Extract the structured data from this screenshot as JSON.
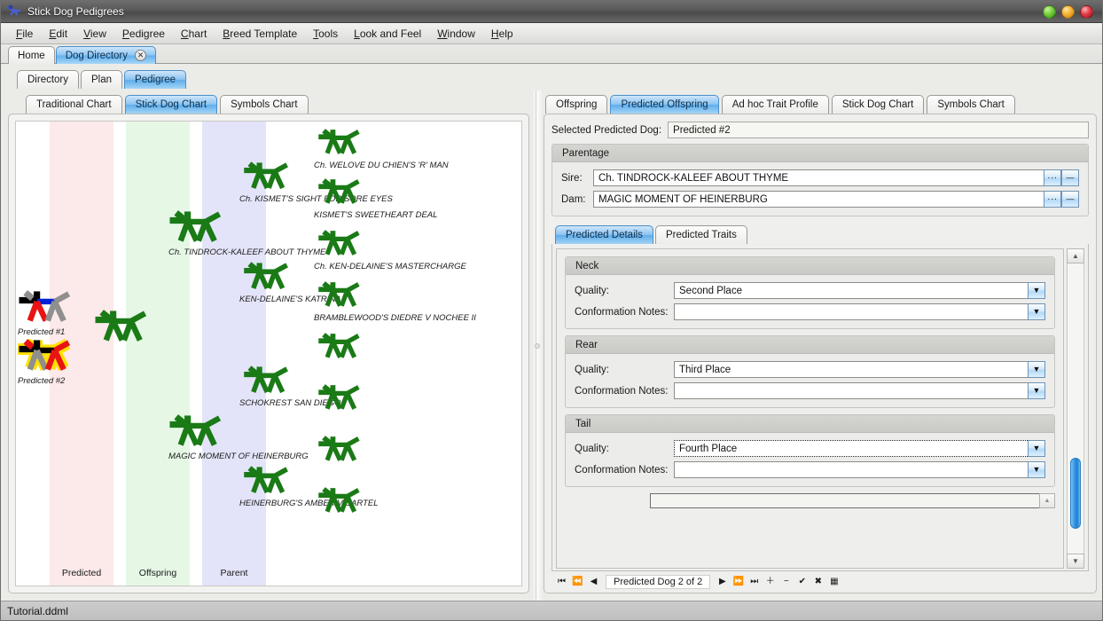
{
  "window": {
    "title": "Stick Dog Pedigrees",
    "app_icon": "stick-dog-icon",
    "buttons": {
      "minimize": "minimize",
      "maximize": "maximize",
      "close": "close"
    }
  },
  "menubar": [
    {
      "label": "File",
      "mnemonic": "F"
    },
    {
      "label": "Edit",
      "mnemonic": "E"
    },
    {
      "label": "View",
      "mnemonic": "V"
    },
    {
      "label": "Pedigree",
      "mnemonic": "P"
    },
    {
      "label": "Chart",
      "mnemonic": "C"
    },
    {
      "label": "Breed Template",
      "mnemonic": "B"
    },
    {
      "label": "Tools",
      "mnemonic": "T"
    },
    {
      "label": "Look and Feel",
      "mnemonic": "L"
    },
    {
      "label": "Window",
      "mnemonic": "W"
    },
    {
      "label": "Help",
      "mnemonic": "H"
    }
  ],
  "document_tabs": [
    {
      "label": "Home",
      "active": false,
      "closable": false
    },
    {
      "label": "Dog Directory",
      "active": true,
      "closable": true,
      "close_glyph": "✕"
    }
  ],
  "inner_tabs": [
    {
      "label": "Directory",
      "active": false
    },
    {
      "label": "Plan",
      "active": false
    },
    {
      "label": "Pedigree",
      "active": true
    }
  ],
  "left_pane": {
    "tabs": [
      {
        "label": "Traditional Chart",
        "active": false
      },
      {
        "label": "Stick Dog Chart",
        "active": true
      },
      {
        "label": "Symbols Chart",
        "active": false
      }
    ],
    "chart": {
      "bands": [
        {
          "label": "Predicted",
          "color": "#fce9e9"
        },
        {
          "label": "Offspring",
          "color": "#e6f7e6"
        },
        {
          "label": "Parent",
          "color": "#e3e4f9"
        }
      ],
      "generation_color": "#1a7a16",
      "dogs": [
        {
          "name": "Predicted #1",
          "generation": "predicted",
          "colored": true,
          "highlight": false
        },
        {
          "name": "Predicted #2",
          "generation": "predicted",
          "colored": true,
          "highlight": true
        },
        {
          "name": "",
          "generation": "offspring",
          "colored": false,
          "highlight": false
        },
        {
          "name": "Ch. TINDROCK-KALEEF ABOUT THYME",
          "generation": "parent",
          "colored": false,
          "highlight": false
        },
        {
          "name": "MAGIC MOMENT OF HEINERBURG",
          "generation": "parent",
          "colored": false,
          "highlight": false
        },
        {
          "name": "Ch. KISMET'S SIGHT FOR SORE EYES",
          "generation": "grandparent",
          "colored": false,
          "highlight": false
        },
        {
          "name": "KEN-DELAINE'S KATRINA",
          "generation": "grandparent",
          "colored": false,
          "highlight": false
        },
        {
          "name": "SCHOKREST SAN DIEGO",
          "generation": "grandparent",
          "colored": false,
          "highlight": false
        },
        {
          "name": "HEINERBURG'S AMBER V CARTEL",
          "generation": "grandparent",
          "colored": false,
          "highlight": false
        },
        {
          "name": "Ch. WELOVE DU CHIEN'S 'R' MAN",
          "generation": "great",
          "colored": false,
          "highlight": false
        },
        {
          "name": "KISMET'S SWEETHEART DEAL",
          "generation": "great",
          "colored": false,
          "highlight": false
        },
        {
          "name": "Ch. KEN-DELAINE'S MASTERCHARGE",
          "generation": "great",
          "colored": false,
          "highlight": false
        },
        {
          "name": "BRAMBLEWOOD'S DIEDRE V NOCHEE II",
          "generation": "great",
          "colored": false,
          "highlight": false
        },
        {
          "name": "",
          "generation": "great",
          "colored": false,
          "highlight": false
        },
        {
          "name": "",
          "generation": "great",
          "colored": false,
          "highlight": false
        },
        {
          "name": "",
          "generation": "great",
          "colored": false,
          "highlight": false
        },
        {
          "name": "",
          "generation": "great",
          "colored": false,
          "highlight": false
        }
      ]
    }
  },
  "right_pane": {
    "tabs": [
      {
        "label": "Offspring",
        "active": false
      },
      {
        "label": "Predicted Offspring",
        "active": true
      },
      {
        "label": "Ad hoc Trait Profile",
        "active": false
      },
      {
        "label": "Stick Dog Chart",
        "active": false
      },
      {
        "label": "Symbols Chart",
        "active": false
      }
    ],
    "selected_dog": {
      "label": "Selected Predicted Dog:",
      "value": "Predicted #2"
    },
    "parentage": {
      "title": "Parentage",
      "fields": [
        {
          "label": "Sire:",
          "value": "Ch. TINDROCK-KALEEF ABOUT THYME",
          "browse": "···",
          "clear": "—"
        },
        {
          "label": "Dam:",
          "value": "MAGIC MOMENT OF HEINERBURG",
          "browse": "···",
          "clear": "—"
        }
      ]
    },
    "sub_tabs": [
      {
        "label": "Predicted Details",
        "active": true
      },
      {
        "label": "Predicted Traits",
        "active": false
      }
    ],
    "detail_groups": [
      {
        "title": "Neck",
        "rows": [
          {
            "label": "Quality:",
            "value": "Second Place",
            "focused": false,
            "arrow": "▼"
          },
          {
            "label": "Conformation Notes:",
            "value": "",
            "focused": false,
            "arrow": "▼"
          }
        ]
      },
      {
        "title": "Rear",
        "rows": [
          {
            "label": "Quality:",
            "value": "Third Place",
            "focused": false,
            "arrow": "▼"
          },
          {
            "label": "Conformation Notes:",
            "value": "",
            "focused": false,
            "arrow": "▼"
          }
        ]
      },
      {
        "title": "Tail",
        "rows": [
          {
            "label": "Quality:",
            "value": "Fourth Place",
            "focused": true,
            "arrow": "▼"
          },
          {
            "label": "Conformation Notes:",
            "value": "",
            "focused": false,
            "arrow": "▼"
          }
        ]
      }
    ],
    "partial_field": {
      "value": "",
      "spinner": "▲"
    },
    "scrollbar": {
      "up": "▲",
      "down": "▼"
    },
    "navigator": {
      "position_text": "Predicted Dog 2 of 2",
      "buttons": [
        {
          "name": "first-record",
          "glyph": "⏮"
        },
        {
          "name": "fast-rewind",
          "glyph": "⏪"
        },
        {
          "name": "previous-record",
          "glyph": "◀"
        },
        {
          "name": "next-record",
          "glyph": "▶"
        },
        {
          "name": "fast-forward",
          "glyph": "⏩"
        },
        {
          "name": "last-record",
          "glyph": "⏭"
        },
        {
          "name": "add-record",
          "glyph": "＋"
        },
        {
          "name": "remove-record",
          "glyph": "−"
        },
        {
          "name": "commit-record",
          "glyph": "✔"
        },
        {
          "name": "cancel-record",
          "glyph": "✖"
        },
        {
          "name": "grid-view",
          "glyph": "▦"
        }
      ]
    }
  },
  "statusbar": {
    "file": "Tutorial.ddml"
  }
}
